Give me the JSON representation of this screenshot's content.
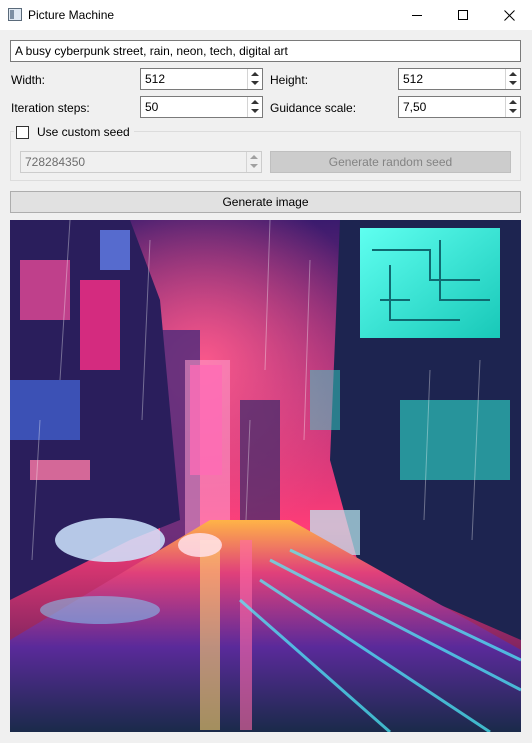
{
  "window": {
    "title": "Picture Machine",
    "icon": "app-window-icon",
    "controls": [
      "minimize-icon",
      "maximize-icon",
      "close-icon"
    ]
  },
  "prompt": {
    "value": "A busy cyberpunk street, rain, neon, tech, digital art"
  },
  "fields": {
    "width_label": "Width:",
    "width_value": "512",
    "height_label": "Height:",
    "height_value": "512",
    "steps_label": "Iteration steps:",
    "steps_value": "50",
    "guidance_label": "Guidance scale:",
    "guidance_value": "7,50"
  },
  "seed": {
    "checkbox_label": "Use custom seed",
    "checked": false,
    "value": "728284350",
    "random_button": "Generate random seed"
  },
  "generate_button": "Generate image",
  "colors": {
    "window_bg": "#f0f0f0",
    "button_bg": "#e1e1e1",
    "disabled_button_bg": "#cccccc",
    "neon_pink": "#ff2e88",
    "neon_cyan": "#2ff0d8",
    "neon_purple": "#7a2cc4"
  }
}
